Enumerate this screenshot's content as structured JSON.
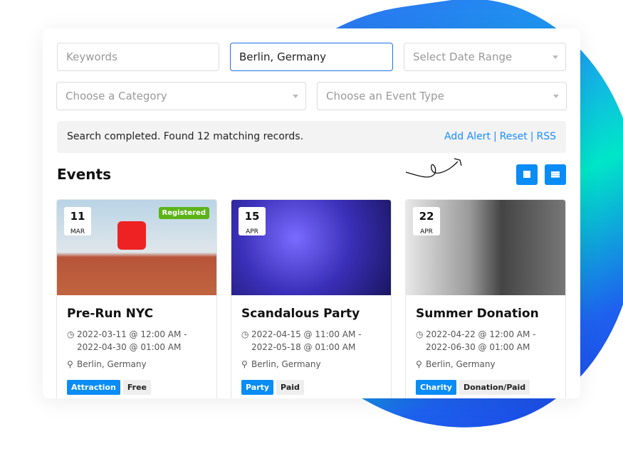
{
  "search": {
    "keywords_placeholder": "Keywords",
    "location_value": "Berlin, Germany",
    "date_placeholder": "Select Date Range",
    "category_placeholder": "Choose a Category",
    "type_placeholder": "Choose an Event Type"
  },
  "status": {
    "text": "Search completed. Found 12 matching records.",
    "add_alert": "Add Alert",
    "reset": "Reset",
    "rss": "RSS",
    "sep": "|"
  },
  "section_title": "Events",
  "colors": {
    "accent": "#0a8cf5",
    "registered": "#5cb318"
  },
  "events": [
    {
      "day": "11",
      "month": "MAR",
      "badge": "Registered",
      "title": "Pre-Run NYC",
      "start": "2022-03-11 @ 12:00 AM -",
      "end": "2022-04-30 @ 01:00 AM",
      "location": "Berlin, Germany",
      "category": "Attraction",
      "price": "Free"
    },
    {
      "day": "15",
      "month": "APR",
      "title": "Scandalous Party",
      "start": "2022-04-15 @ 11:00 AM -",
      "end": "2022-05-18 @ 01:00 AM",
      "location": "Berlin, Germany",
      "category": "Party",
      "price": "Paid"
    },
    {
      "day": "22",
      "month": "APR",
      "title": "Summer Donation",
      "start": "2022-04-22 @ 12:00 AM -",
      "end": "2022-06-30 @ 01:00 AM",
      "location": "Berlin, Germany",
      "category": "Charity",
      "price": "Donation/Paid"
    }
  ]
}
